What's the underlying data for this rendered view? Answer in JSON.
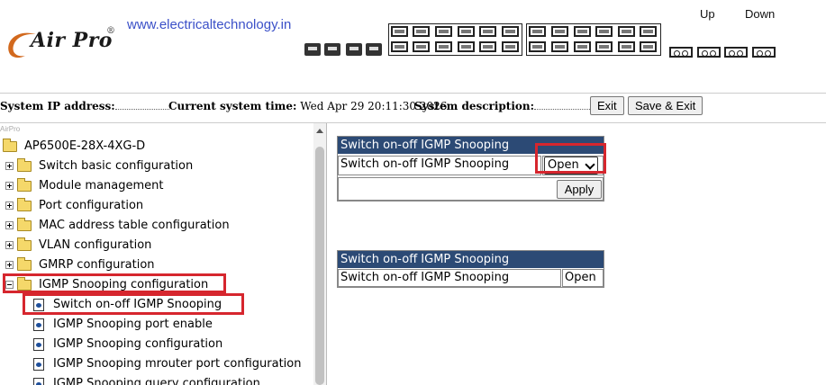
{
  "header": {
    "brand": "Air Pro",
    "brand_mark": "®",
    "site_url": "www.electricaltechnology.in",
    "up_label": "Up",
    "down_label": "Down"
  },
  "status": {
    "ip_label": "System IP address:",
    "time_label": "Current system time:",
    "time_value": "Wed Apr 29 20:11:30 2026",
    "desc_label": "System description:",
    "exit_label": "Exit",
    "save_exit_label": "Save & Exit"
  },
  "tree": {
    "caption": "AirPro",
    "root": "AP6500E-28X-4XG-D",
    "items": [
      "Switch basic configuration",
      "Module management",
      "Port configuration",
      "MAC address table configuration",
      "VLAN configuration",
      "GMRP configuration",
      "IGMP Snooping configuration"
    ],
    "sub_items": [
      "Switch on-off IGMP Snooping",
      "IGMP Snooping port enable",
      "IGMP Snooping configuration",
      "IGMP Snooping mrouter port configuration",
      "IGMP Snooping query configuration"
    ]
  },
  "form_panel": {
    "title": "Switch on-off IGMP Snooping",
    "row_label": "Switch on-off IGMP Snooping",
    "select_value": "Open",
    "apply_label": "Apply"
  },
  "status_panel": {
    "title": "Switch on-off IGMP Snooping",
    "row_label": "Switch on-off IGMP Snooping",
    "row_value": "Open"
  },
  "colors": {
    "panel_header": "#2c4a75",
    "highlight": "#d6262e",
    "link": "#3b50c8"
  }
}
